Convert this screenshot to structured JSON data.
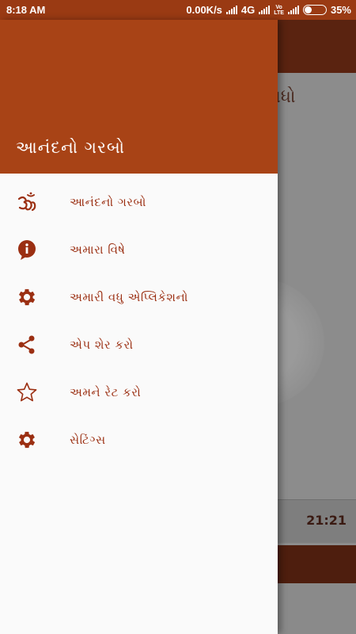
{
  "status_bar": {
    "time": "8:18 AM",
    "network_speed": "0.00K/s",
    "network_type": "4G",
    "volte": "Vo\nLTE",
    "battery_percent": "35%",
    "battery_level": 0.35
  },
  "background": {
    "title": "નંદ વાધો",
    "duration": "21:21"
  },
  "drawer": {
    "title": "આનંદનો ગરબો",
    "items": [
      {
        "label": "આનંદનો ગરબો",
        "icon": "om-icon"
      },
      {
        "label": "અમારા વિષે",
        "icon": "info-icon"
      },
      {
        "label": "અમારી વધુ એપ્લિકેશનો",
        "icon": "gear-icon"
      },
      {
        "label": "એપ શેર કરો",
        "icon": "share-icon"
      },
      {
        "label": "અમને રેટ કરો",
        "icon": "star-icon"
      },
      {
        "label": "સેટિંગ્સ",
        "icon": "gear-icon"
      }
    ]
  },
  "colors": {
    "accent": "#a84316",
    "status_bar": "#9a3a13",
    "label": "#9b2f12"
  }
}
